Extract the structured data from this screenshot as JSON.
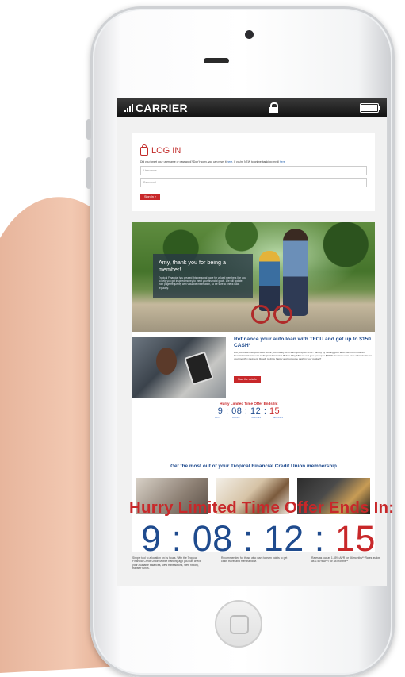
{
  "statusbar": {
    "carrier": "CARRIER"
  },
  "login": {
    "title": "LOG IN",
    "note_prefix": "Did you forget your username or password? Don't worry, you can reset it",
    "note_link_here": "here",
    "note_middle": ". If you're NEW to online banking enroll",
    "note_link_enroll": "here",
    "username_placeholder": "Username",
    "password_placeholder": "Password",
    "sign_in_label": "Sign In »"
  },
  "hero": {
    "heading": "Amy, thank you for being a member!",
    "body": "Tropical Financial has created this personal page for valued members like you to help you get inspired money to meet your financial goals. We will update your page frequently with valuable information, so be sure to check back regularly."
  },
  "refinance": {
    "title": "Refinance your auto loan with TFCU and get up to $150 CASH*",
    "body": "Did you know that you could SAVE you money AND earn you up to $150? Simply by moving your auto loan from another financial institution over to Tropical Financial. Before May 15th we will give you up to $150*! You may even save a few bucks on your monthly payment. Ready to drive happy and put some cash in your pocket?",
    "button": "Start the details"
  },
  "mini_timer": {
    "heading": "Hurry Limited Time Offer Ends In:",
    "days": "9",
    "hours": "08",
    "minutes": "12",
    "seconds": "15",
    "units": [
      "DAYS",
      "HOURS",
      "MINUTES",
      "SECONDS"
    ]
  },
  "membership": {
    "heading": "Get the most out of your Tropical Financial Credit Union membership"
  },
  "big_timer": {
    "headline": "Hurry Limited Time Offer Ends In:",
    "days": "9",
    "hours": "08",
    "minutes": "12",
    "seconds": "15"
  },
  "bottom_columns": [
    "Simple tool to a location on its hours. With the Tropical Financial Credit Union Mobile Banking app you can check your available balances, view transactions, view history, transfer funds.",
    "Recommended for those who want to earn points to get cash, travel and merchandise.",
    "Rates as low as 1.45% APR for 36 months** Rates as low as 2.50% APR for 48 months**"
  ],
  "colors": {
    "brand_red": "#c8282a",
    "brand_blue": "#1f4b8e"
  }
}
